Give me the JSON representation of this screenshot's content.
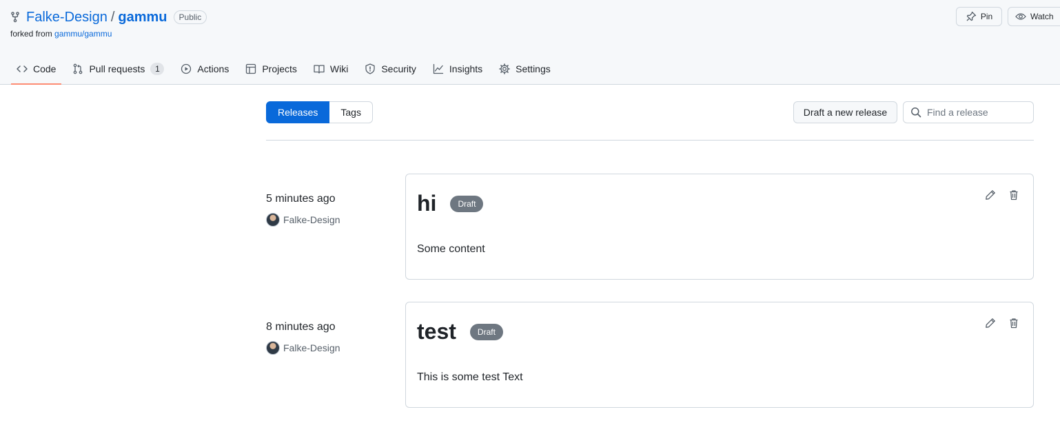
{
  "repo": {
    "owner": "Falke-Design",
    "name": "gammu",
    "visibility": "Public",
    "forked_prefix": "forked from",
    "forked_source": "gammu/gammu",
    "pin_label": "Pin",
    "watch_label": "Watch"
  },
  "tabs": [
    {
      "label": "Code",
      "icon": "code-icon",
      "active": true
    },
    {
      "label": "Pull requests",
      "icon": "pull-request-icon",
      "counter": "1"
    },
    {
      "label": "Actions",
      "icon": "play-icon"
    },
    {
      "label": "Projects",
      "icon": "table-icon"
    },
    {
      "label": "Wiki",
      "icon": "book-icon"
    },
    {
      "label": "Security",
      "icon": "shield-icon"
    },
    {
      "label": "Insights",
      "icon": "graph-icon"
    },
    {
      "label": "Settings",
      "icon": "gear-icon"
    }
  ],
  "subnav": {
    "releases": "Releases",
    "tags": "Tags"
  },
  "draft_button": "Draft a new release",
  "search": {
    "placeholder": "Find a release"
  },
  "releases": [
    {
      "time": "5 minutes ago",
      "author": "Falke-Design",
      "title": "hi",
      "badge": "Draft",
      "body": "Some content"
    },
    {
      "time": "8 minutes ago",
      "author": "Falke-Design",
      "title": "test",
      "badge": "Draft",
      "body": "This is some test Text"
    }
  ],
  "colors": {
    "accent": "#0969da",
    "tab_underline": "#fd8c73",
    "draft_badge": "#6e7781"
  }
}
